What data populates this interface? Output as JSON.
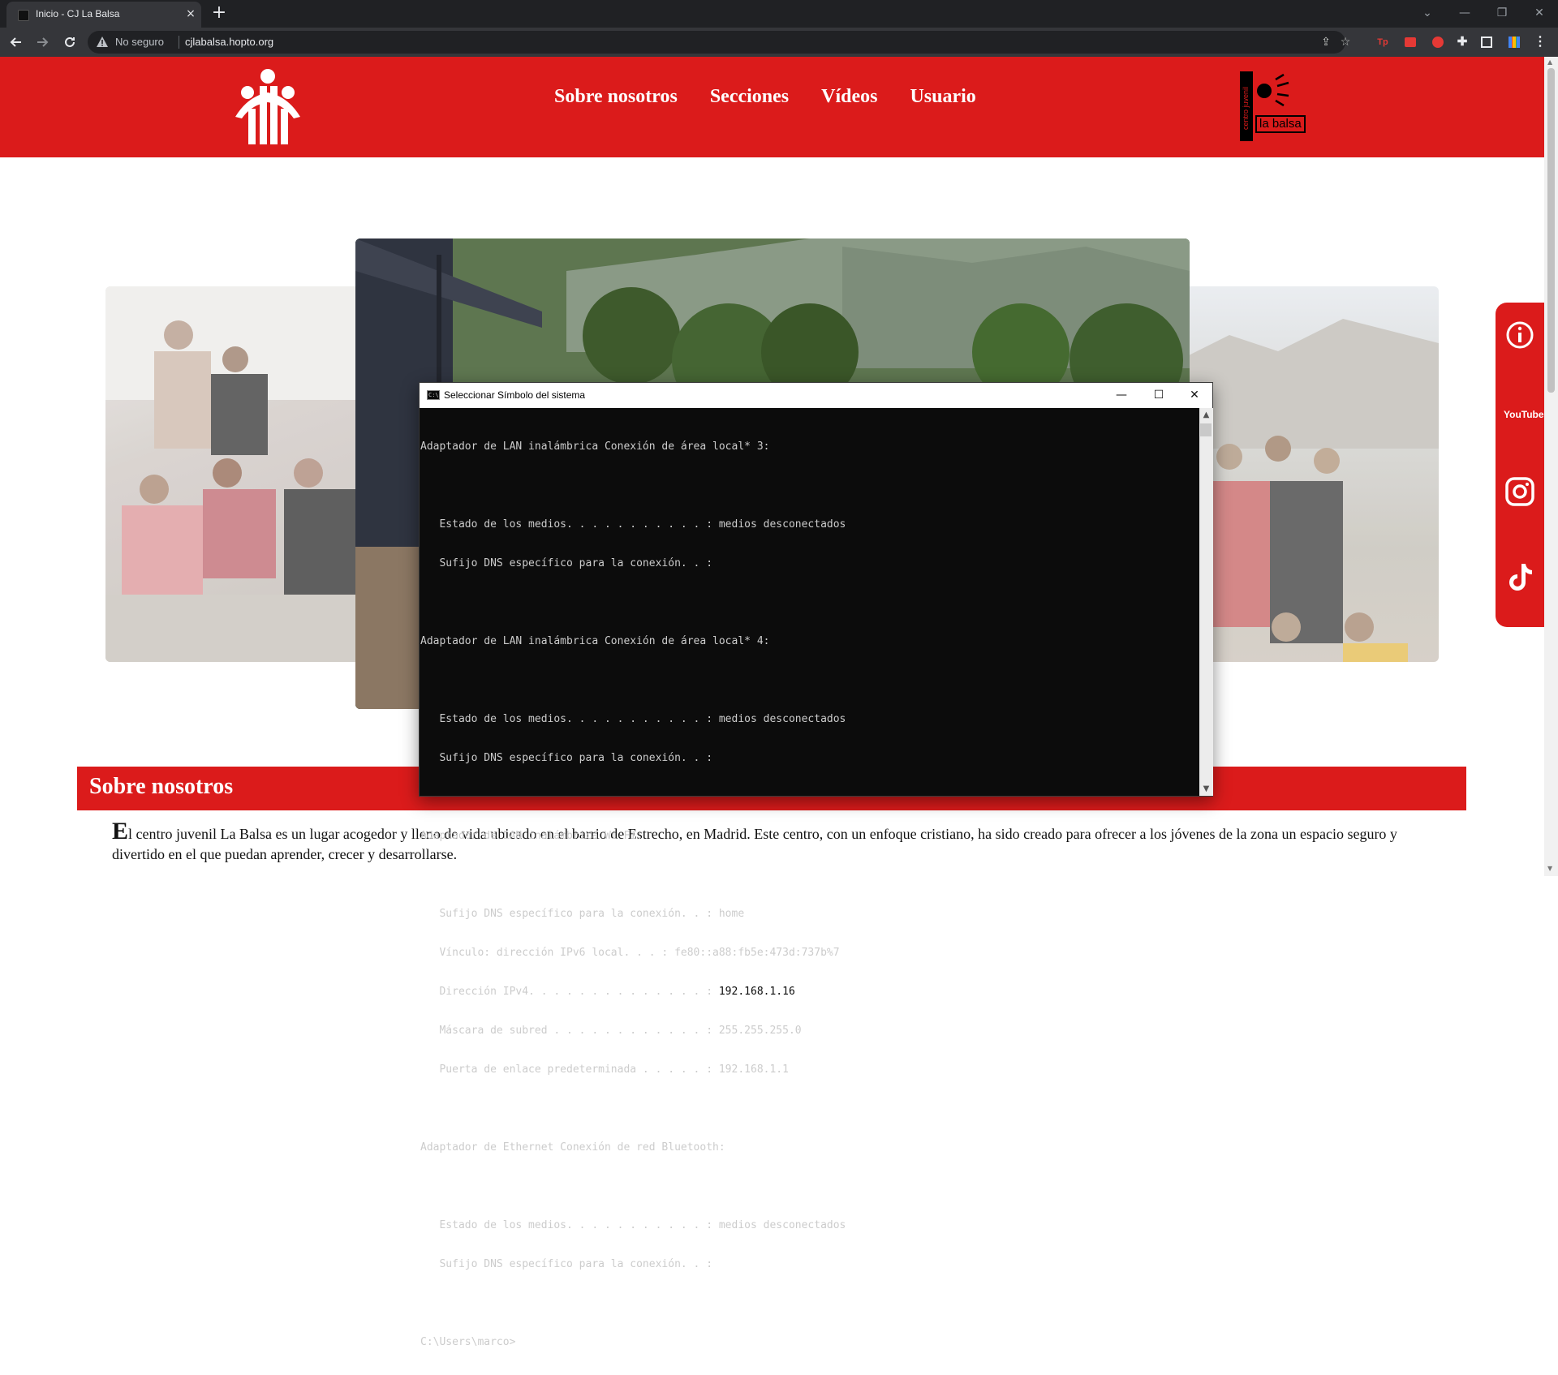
{
  "browser": {
    "tab_title": "Inicio - CJ La Balsa",
    "tab_close": "×",
    "new_tab": "+",
    "security_label": "No seguro",
    "url": "cjlabalsa.hopto.org",
    "extension_tp": "Tp",
    "window_controls": {
      "dropdown": "⌄",
      "minimize": "—",
      "restore": "❐",
      "close": "✕"
    }
  },
  "site": {
    "nav": [
      "Sobre nosotros",
      "Secciones",
      "Vídeos",
      "Usuario"
    ],
    "brand_vertical": "centro juvenil",
    "brand_name": "la balsa",
    "section_title": "Sobre nosotros",
    "intro_dropcap": "E",
    "intro_text": "l centro juvenil La Balsa es un lugar acogedor y lleno de vida ubicado en el barrio de Estrecho, en Madrid. Este centro, con un enfoque cristiano, ha sido creado para ofrecer a los jóvenes de la zona un espacio seguro y divertido en el que puedan aprender, crecer y desarrollarse.",
    "social": [
      "info-icon",
      "youtube-icon",
      "instagram-icon",
      "tiktok-icon"
    ],
    "youtube_label": "YouTube"
  },
  "cmd": {
    "title": "Seleccionar Símbolo del sistema",
    "controls": {
      "minimize": "—",
      "maximize": "☐",
      "close": "✕"
    },
    "lines": [
      "Adaptador de LAN inalámbrica Conexión de área local* 3:",
      "",
      "   Estado de los medios. . . . . . . . . . . : medios desconectados",
      "   Sufijo DNS específico para la conexión. . :",
      "",
      "Adaptador de LAN inalámbrica Conexión de área local* 4:",
      "",
      "   Estado de los medios. . . . . . . . . . . : medios desconectados",
      "   Sufijo DNS específico para la conexión. . :",
      "",
      "Adaptador de LAN inalámbrica Wi-Fi:",
      "",
      "   Sufijo DNS específico para la conexión. . : home",
      "   Vínculo: dirección IPv6 local. . . : fe80::a88:fb5e:473d:737b%7"
    ],
    "ipv4_prefix": "   Dirección IPv4. . . . . . . . . . . . . . : ",
    "ipv4_value": "192.168.1.16",
    "lines_after": [
      "   Máscara de subred . . . . . . . . . . . . : 255.255.255.0",
      "   Puerta de enlace predeterminada . . . . . : 192.168.1.1",
      "",
      "Adaptador de Ethernet Conexión de red Bluetooth:",
      "",
      "   Estado de los medios. . . . . . . . . . . : medios desconectados",
      "   Sufijo DNS específico para la conexión. . :",
      "",
      "C:\\Users\\marco>"
    ]
  },
  "colors": {
    "brand_red": "#db1b1b",
    "chrome_dark": "#202124",
    "terminal_bg": "#0c0c0c",
    "terminal_text": "#cccccc"
  }
}
